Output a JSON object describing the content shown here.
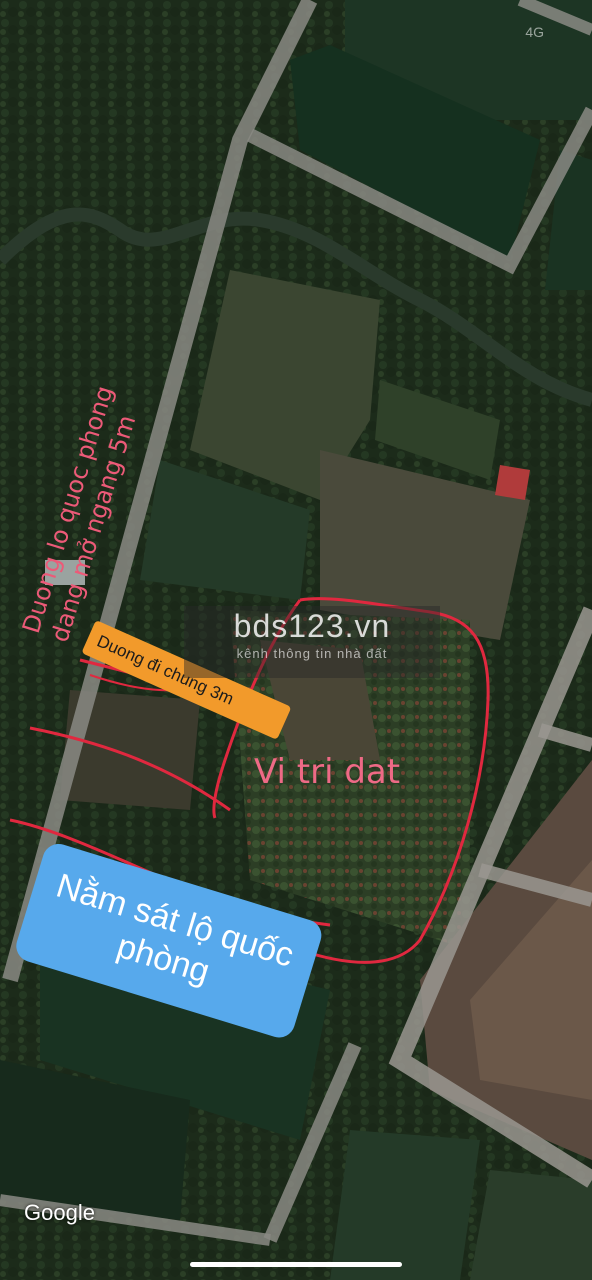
{
  "map": {
    "labels": {
      "road_main_line1": "Duong lo quoc phong",
      "road_main_line2": "dang mở ngang 5m",
      "road_shared": "Duong đi chung 3m",
      "plot": "Vi tri dat",
      "proximity_line1": "Nằm sát lộ quốc",
      "proximity_line2": "phòng"
    },
    "watermark": {
      "title": "bds123.vn",
      "subtitle": "kênh thông tin nhà đất"
    },
    "attribution": "Google",
    "status_bar": {
      "network": "4G"
    },
    "colors": {
      "annotation_red": "#e0283f",
      "pink_text": "#ec5a78",
      "orange_badge": "#f29a2b",
      "blue_badge": "#57a9ec"
    },
    "icons": [
      "home-indicator"
    ]
  }
}
